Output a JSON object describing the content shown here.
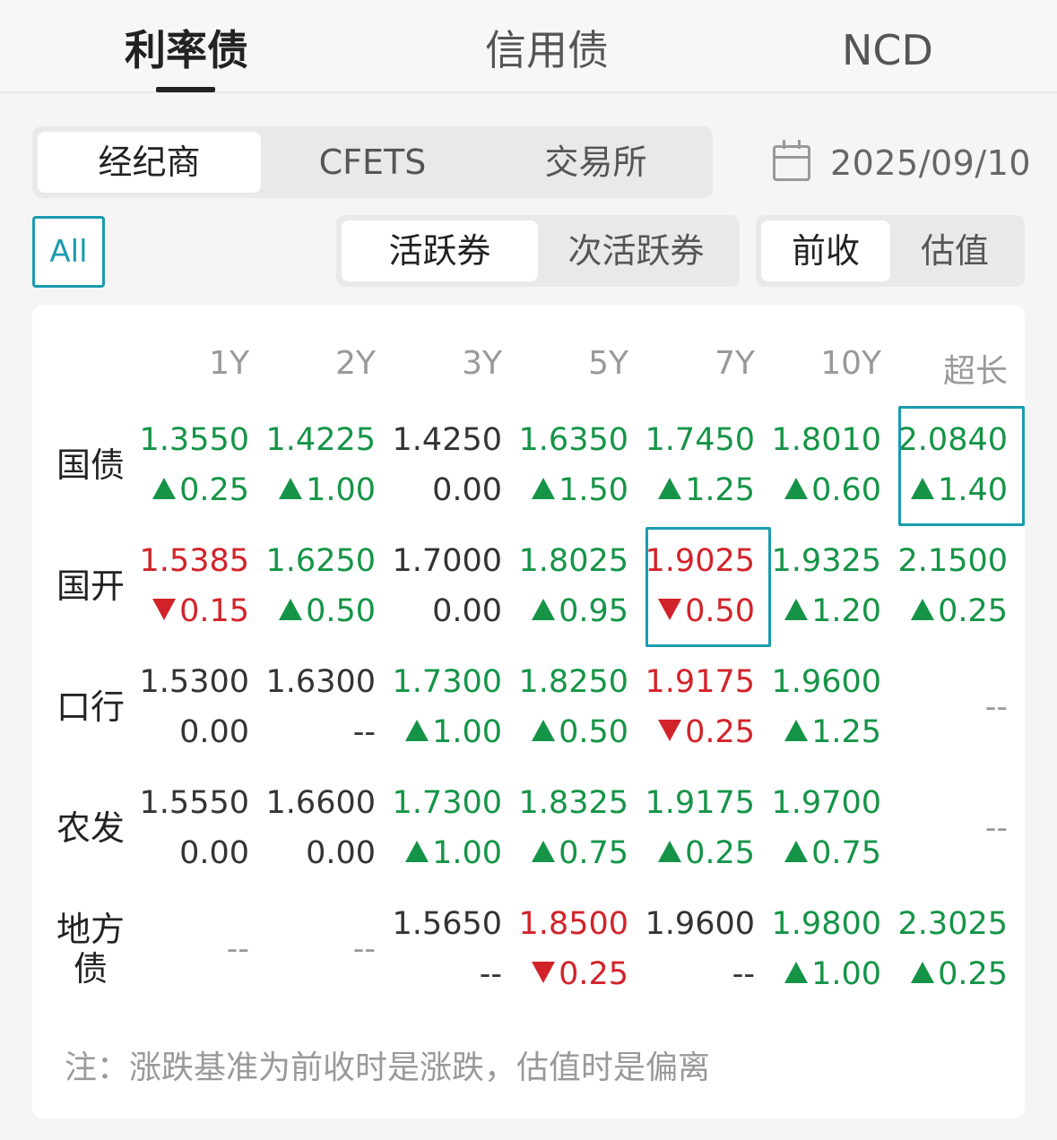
{
  "top_tabs": [
    "利率债",
    "信用债",
    "NCD"
  ],
  "market_tabs": [
    "经纪商",
    "CFETS",
    "交易所"
  ],
  "date": "2025/09/10",
  "filter_all": "All",
  "active_tabs": [
    "活跃券",
    "次活跃券"
  ],
  "base_tabs": [
    "前收",
    "估值"
  ],
  "columns": [
    "1Y",
    "2Y",
    "3Y",
    "5Y",
    "7Y",
    "10Y",
    "超长"
  ],
  "rows": [
    {
      "label": "国债",
      "cells": [
        {
          "value": "1.3550",
          "change": "0.25",
          "dir": "up"
        },
        {
          "value": "1.4225",
          "change": "1.00",
          "dir": "up"
        },
        {
          "value": "1.4250",
          "change": "0.00",
          "dir": "flat"
        },
        {
          "value": "1.6350",
          "change": "1.50",
          "dir": "up"
        },
        {
          "value": "1.7450",
          "change": "1.25",
          "dir": "up"
        },
        {
          "value": "1.8010",
          "change": "0.60",
          "dir": "up"
        },
        {
          "value": "2.0840",
          "change": "1.40",
          "dir": "up"
        }
      ]
    },
    {
      "label": "国开",
      "cells": [
        {
          "value": "1.5385",
          "change": "0.15",
          "dir": "down"
        },
        {
          "value": "1.6250",
          "change": "0.50",
          "dir": "up"
        },
        {
          "value": "1.7000",
          "change": "0.00",
          "dir": "flat"
        },
        {
          "value": "1.8025",
          "change": "0.95",
          "dir": "up"
        },
        {
          "value": "1.9025",
          "change": "0.50",
          "dir": "down"
        },
        {
          "value": "1.9325",
          "change": "1.20",
          "dir": "up"
        },
        {
          "value": "2.1500",
          "change": "0.25",
          "dir": "up"
        }
      ]
    },
    {
      "label": "口行",
      "cells": [
        {
          "value": "1.5300",
          "change": "0.00",
          "dir": "flat"
        },
        {
          "value": "1.6300",
          "change": "--",
          "dir": "flat"
        },
        {
          "value": "1.7300",
          "change": "1.00",
          "dir": "up"
        },
        {
          "value": "1.8250",
          "change": "0.50",
          "dir": "up"
        },
        {
          "value": "1.9175",
          "change": "0.25",
          "dir": "down"
        },
        {
          "value": "1.9600",
          "change": "1.25",
          "dir": "up"
        },
        {
          "value": "--",
          "change": "",
          "dir": "none"
        }
      ]
    },
    {
      "label": "农发",
      "cells": [
        {
          "value": "1.5550",
          "change": "0.00",
          "dir": "flat"
        },
        {
          "value": "1.6600",
          "change": "0.00",
          "dir": "flat"
        },
        {
          "value": "1.7300",
          "change": "1.00",
          "dir": "up"
        },
        {
          "value": "1.8325",
          "change": "0.75",
          "dir": "up"
        },
        {
          "value": "1.9175",
          "change": "0.25",
          "dir": "up"
        },
        {
          "value": "1.9700",
          "change": "0.75",
          "dir": "up"
        },
        {
          "value": "--",
          "change": "",
          "dir": "none"
        }
      ]
    },
    {
      "label": "地方债",
      "cells": [
        {
          "value": "--",
          "change": "",
          "dir": "none"
        },
        {
          "value": "--",
          "change": "",
          "dir": "none"
        },
        {
          "value": "1.5650",
          "change": "--",
          "dir": "flat"
        },
        {
          "value": "1.8500",
          "change": "0.25",
          "dir": "down"
        },
        {
          "value": "1.9600",
          "change": "--",
          "dir": "flat"
        },
        {
          "value": "1.9800",
          "change": "1.00",
          "dir": "up"
        },
        {
          "value": "2.3025",
          "change": "0.25",
          "dir": "up"
        }
      ]
    }
  ],
  "note": "注：涨跌基准为前收时是涨跌，估值时是偏离"
}
